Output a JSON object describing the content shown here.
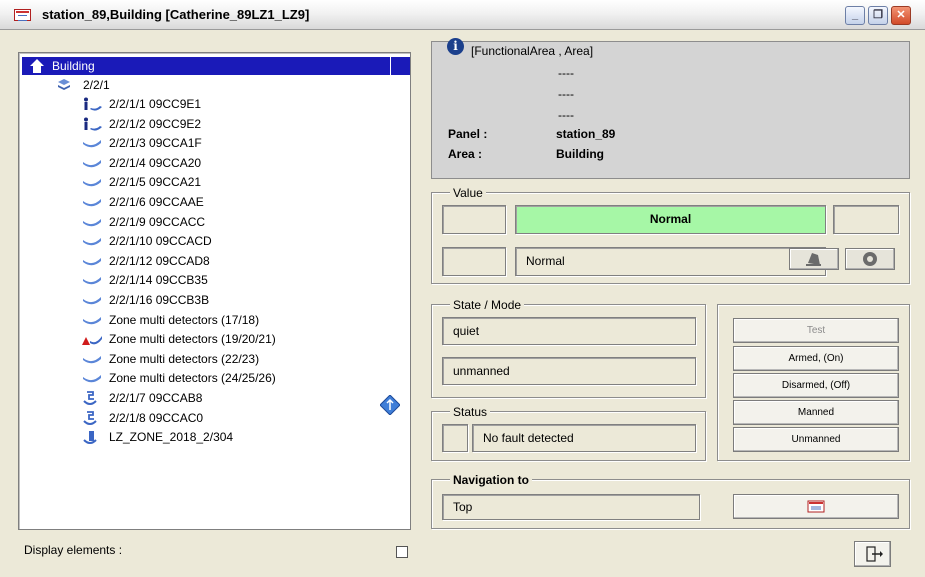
{
  "window": {
    "title": "station_89,Building [Catherine_89LZ1_LZ9]",
    "minimize_icon": "minimize-icon",
    "restore_icon": "restore-icon",
    "close_icon": "close-icon"
  },
  "tree": {
    "root_label": "Building",
    "group_label": "2/2/1",
    "items": [
      {
        "label": "2/2/1/1 09CC9E1",
        "icon": "person-detector-icon"
      },
      {
        "label": "2/2/1/2 09CC9E2",
        "icon": "person-detector-icon"
      },
      {
        "label": "2/2/1/3 09CCA1F",
        "icon": "smoke-detector-icon"
      },
      {
        "label": "2/2/1/4 09CCA20",
        "icon": "smoke-detector-icon"
      },
      {
        "label": "2/2/1/5 09CCA21",
        "icon": "smoke-detector-icon"
      },
      {
        "label": "2/2/1/6 09CCAAE",
        "icon": "smoke-detector-icon"
      },
      {
        "label": "2/2/1/9 09CCACC",
        "icon": "smoke-detector-icon"
      },
      {
        "label": "2/2/1/10 09CCACD",
        "icon": "smoke-detector-icon"
      },
      {
        "label": "2/2/1/12 09CCAD8",
        "icon": "smoke-detector-icon"
      },
      {
        "label": "2/2/1/14 09CCB35",
        "icon": "smoke-detector-icon"
      },
      {
        "label": "2/2/1/16 09CCB3B",
        "icon": "smoke-detector-icon"
      },
      {
        "label": "Zone multi detectors (17/18)",
        "icon": "smoke-detector-icon"
      },
      {
        "label": "Zone multi detectors (19/20/21)",
        "icon": "alarm-detector-icon"
      },
      {
        "label": "Zone multi detectors (22/23)",
        "icon": "smoke-detector-icon"
      },
      {
        "label": "Zone multi detectors (24/25/26)",
        "icon": "smoke-detector-icon"
      },
      {
        "label": "2/2/1/7 09CCAB8",
        "icon": "sounder-icon"
      },
      {
        "label": "2/2/1/8 09CCAC0",
        "icon": "sounder-icon"
      },
      {
        "label": "LZ_ZONE_2018_2/304",
        "icon": "zone-icon"
      }
    ]
  },
  "footer": {
    "display_elements_label": "Display elements :"
  },
  "info": {
    "header": "[FunctionalArea , Area]",
    "dash_lines": [
      "----",
      "----",
      "----"
    ],
    "panel_label": "Panel :",
    "panel_value": "station_89",
    "area_label": "Area :",
    "area_value": "Building"
  },
  "value_group": {
    "legend": "Value",
    "status": "Normal",
    "detail": "Normal",
    "status_color": "#a6f7a6"
  },
  "state_group": {
    "legend": "State / Mode",
    "state": "quiet",
    "mode": "unmanned"
  },
  "status_group": {
    "legend": "Status",
    "text": "No fault detected"
  },
  "commands": {
    "test": "Test",
    "armed": "Armed, (On)",
    "disarmed": "Disarmed, (Off)",
    "manned": "Manned",
    "unmanned": "Unmanned"
  },
  "navigation": {
    "legend": "Navigation to",
    "target": "Top"
  }
}
